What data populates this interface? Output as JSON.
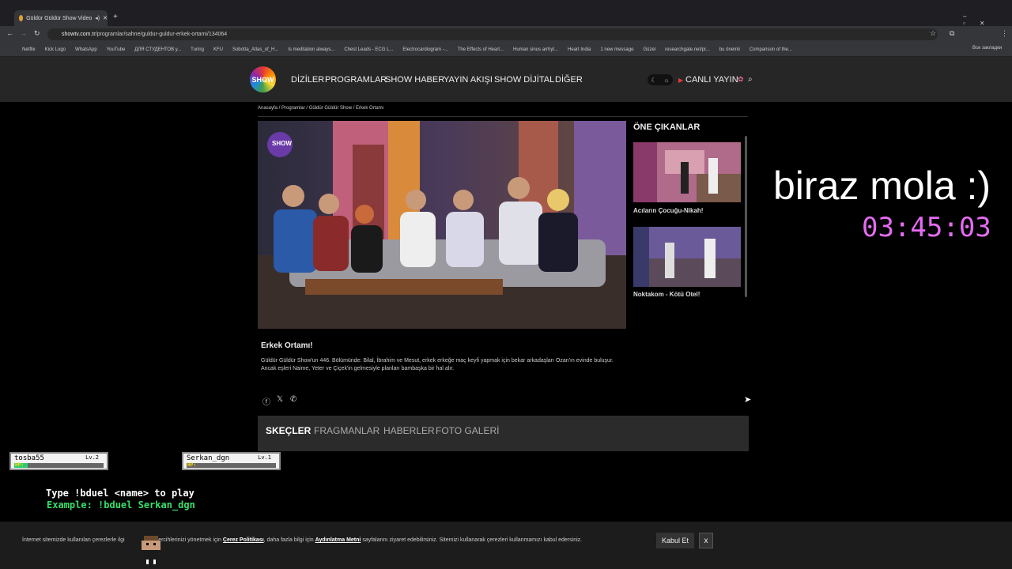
{
  "browser": {
    "tab_title": "Güldür Güldür Show Video",
    "url_scheme": "showtv.com.tr",
    "url_path": "/programlar/sahne/guldur-guldur-erkek-ortami/134064",
    "bookmarks": [
      "Netflix",
      "Kick Logo",
      "WhatsApp",
      "YouTube",
      "ДЛЯ СТУДЕНТОВ у...",
      "Turing",
      "KFU",
      "Sobotta_Atlas_of_H...",
      "Is meditation always...",
      "Chest Leads - ECG L...",
      "Electrocardiogram -...",
      "The Effects of Heart...",
      "Human sinus arrhyt...",
      "Heart India",
      "1 new message",
      "Güzel",
      "researchgate.net/pr...",
      "bu önemli",
      "Comparison of the..."
    ],
    "other_bookmarks": "Все закладки"
  },
  "site": {
    "logo_text": "SHOW",
    "nav": [
      "DİZİLER",
      "PROGRAMLAR",
      "SHOW HABER",
      "YAYIN AKIŞI",
      "SHOW DİJİTAL",
      "DİĞER"
    ],
    "live_label": "CANLI YAYIN"
  },
  "breadcrumb": "Anasayfa / Programlar / Güldür Güldür Show / Erkek Ortamı",
  "sidebar": {
    "title": "ÖNE ÇIKANLAR",
    "items": [
      {
        "title": "Acıların Çocuğu-Nikah!"
      },
      {
        "title": "Noktakom - Kötü Otel!"
      }
    ]
  },
  "episode": {
    "title": "Erkek Ortamı!",
    "description": "Güldür Güldür Show'un 446. Bölümünde: Bilal, İbrahim ve Mesut, erkek erkeğe maç keyfi yapmak için bekar arkadaşları Ozan'ın evinde buluşur. Ancak eşleri Naime, Yeter ve Çiçek'in gelmesiyle planları bambaşka bir hal alır."
  },
  "content_tabs": [
    "SKEÇLER",
    "FRAGMANLAR",
    "HABERLER",
    "FOTO GALERİ"
  ],
  "overlay": {
    "break_text": "biraz mola :)",
    "timer": "03:45:03",
    "players": [
      {
        "name": "tosba55",
        "level": "Lv.2",
        "hp": 0.15
      },
      {
        "name": "Serkan_dgn",
        "level": "Lv.1",
        "hp": 0.0
      }
    ],
    "hp_label": "HP:",
    "instruction": "Type !bduel <name> to play",
    "example": "Example: !bduel Serkan_dgn"
  },
  "cookie": {
    "text_1": "İnternet sitemizde kullanılan çerezlerle ilgi",
    "text_2": "k ve tercihlerinizi yönetmek için",
    "link_1": "Çerez Politikası",
    "text_3": ", daha fazla bilgi için",
    "link_2": "Aydınlatma Metni",
    "text_4": "sayfalarını ziyaret edebilirsiniz. Sitemizi kullanarak çerezleri kullanmamızı kabul edersiniz.",
    "accept_label": "Kabul Et",
    "close_label": "x"
  },
  "colors": {
    "timer": "#e46cf0",
    "hp": "#2ecc71",
    "example": "#35e06a"
  }
}
